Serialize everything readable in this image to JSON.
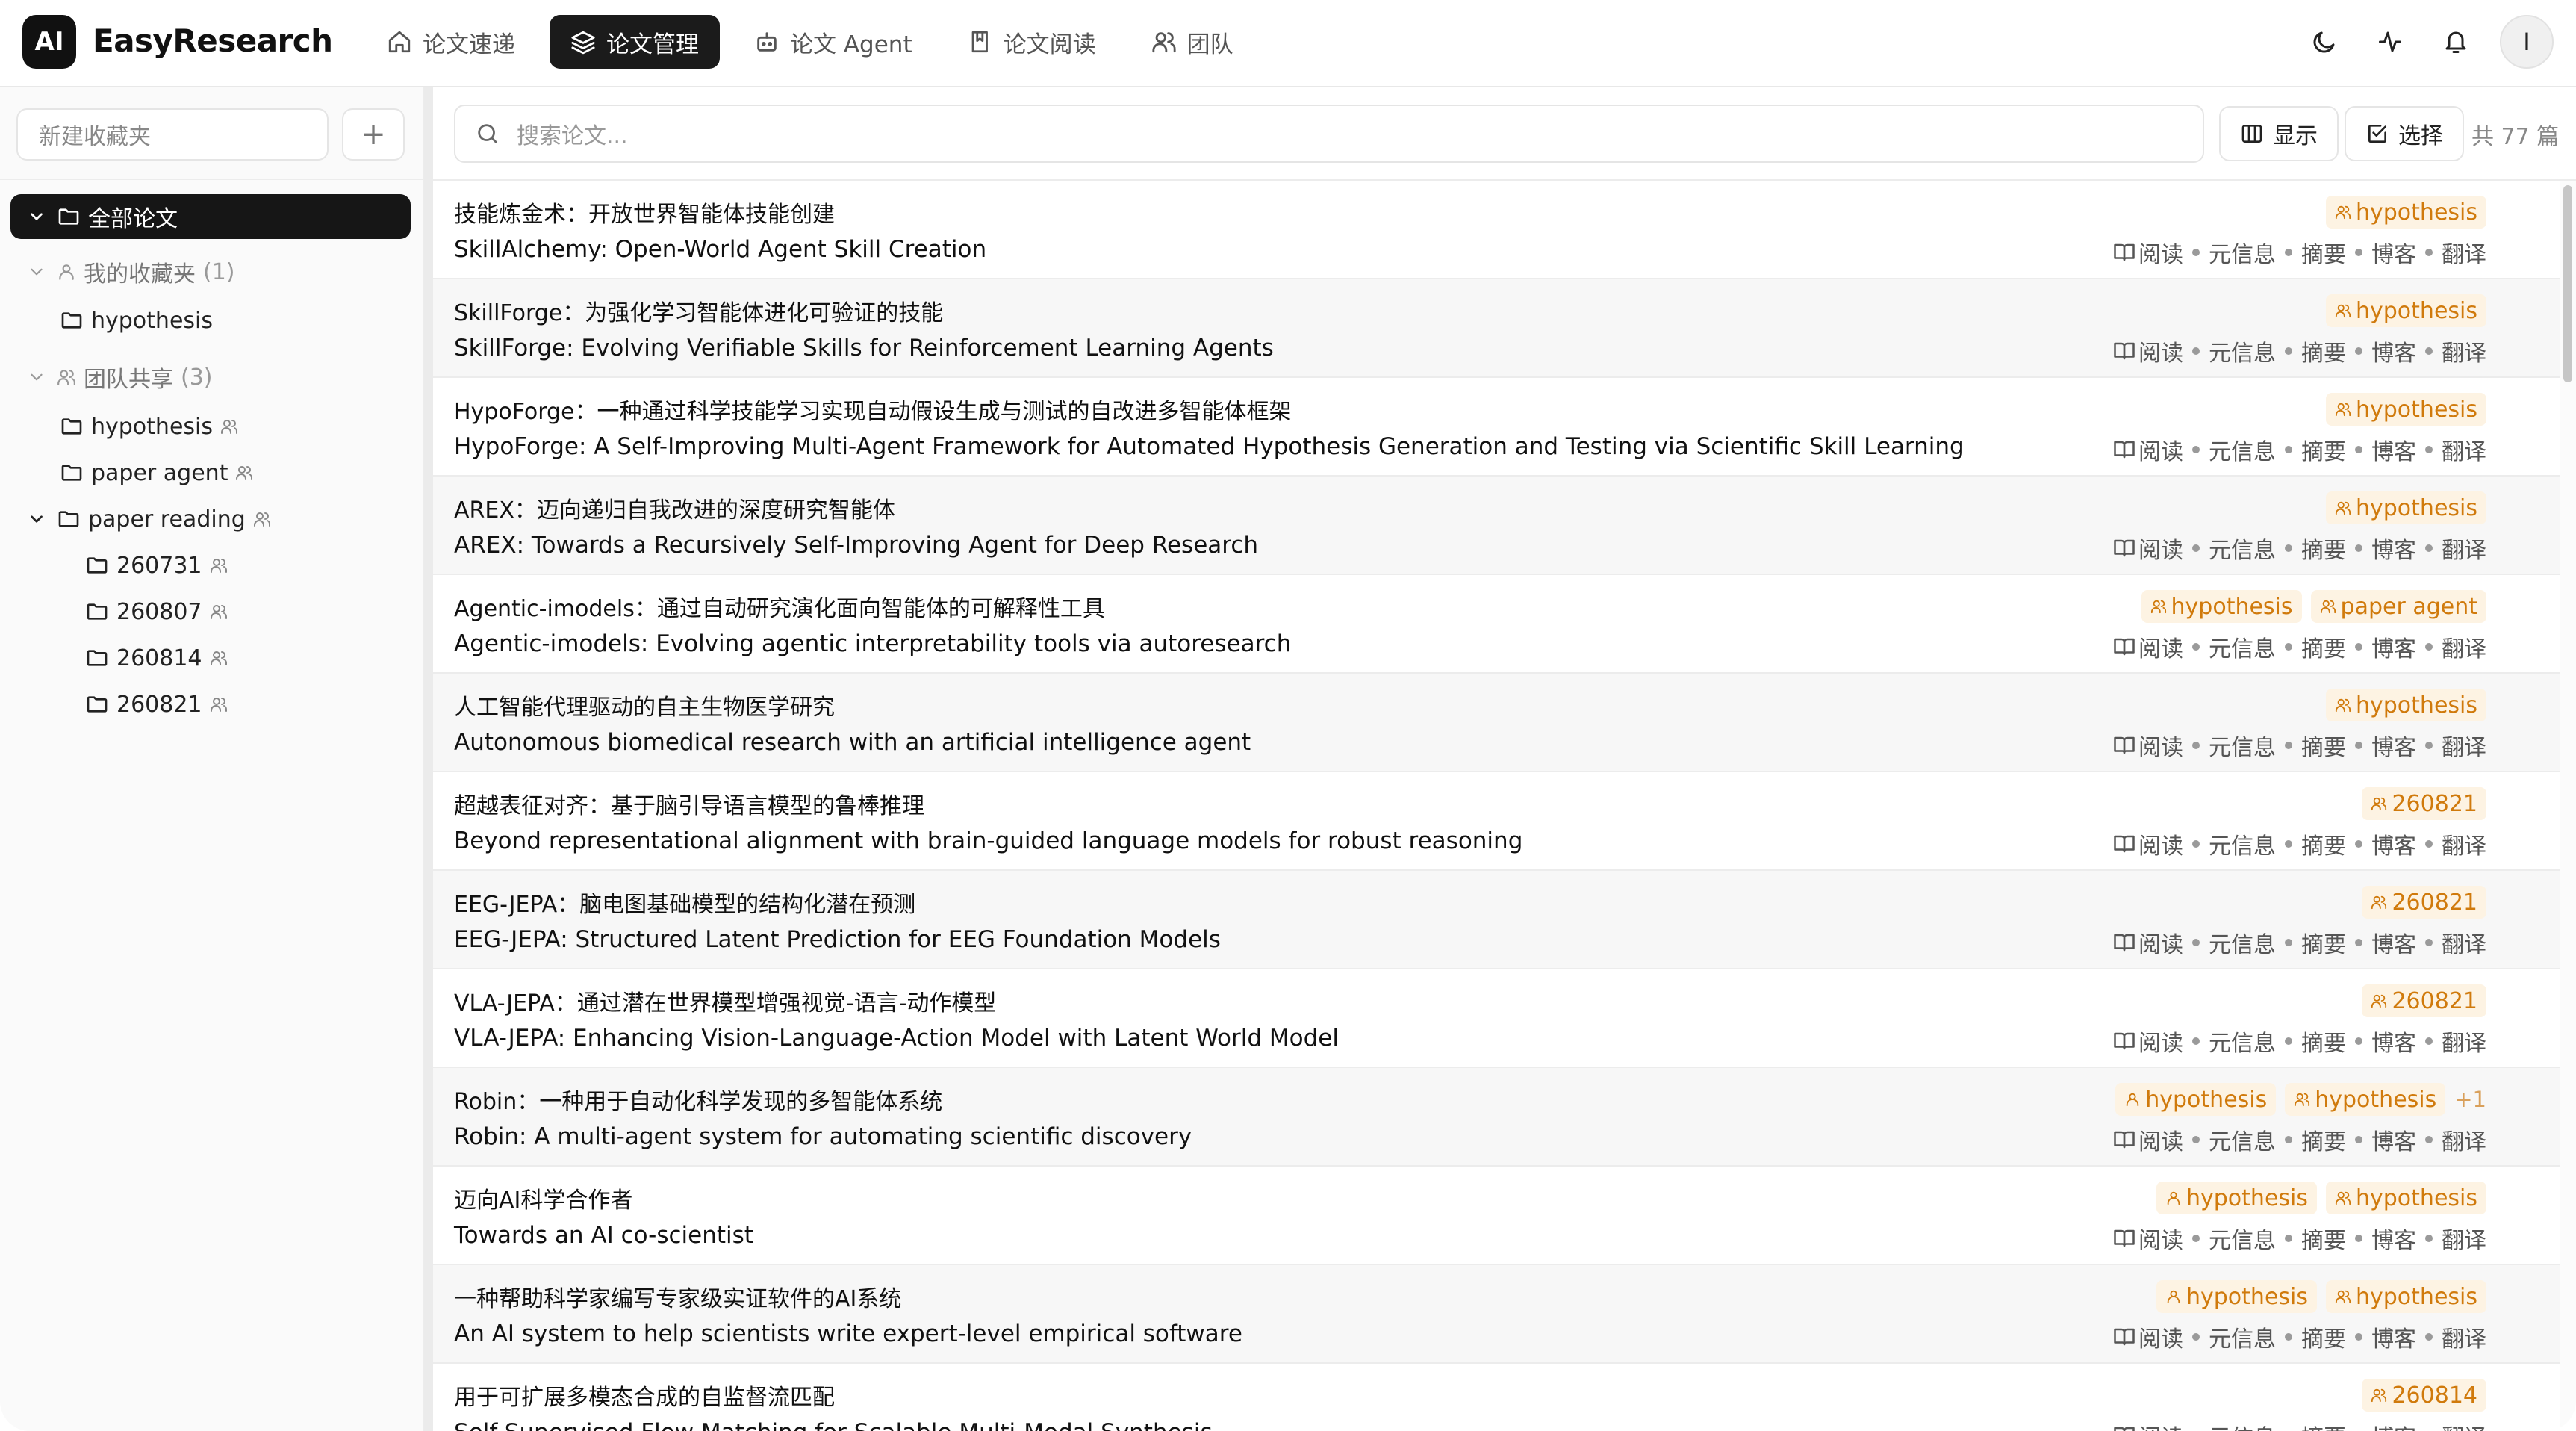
{
  "app": {
    "logo_text": "AI",
    "name": "EasyResearch"
  },
  "nav": [
    {
      "label": "论文速递",
      "icon": "home-icon",
      "active": false
    },
    {
      "label": "论文管理",
      "icon": "layers-icon",
      "active": true
    },
    {
      "label": "论文 Agent",
      "icon": "bot-icon",
      "active": false
    },
    {
      "label": "论文阅读",
      "icon": "book-icon",
      "active": false
    },
    {
      "label": "团队",
      "icon": "users-icon",
      "active": false
    }
  ],
  "header_icons": [
    "moon-icon",
    "activity-icon",
    "bell-icon"
  ],
  "user": {
    "initial": "I"
  },
  "sidebar": {
    "new_folder_placeholder": "新建收藏夹",
    "add_label": "+",
    "all_papers": "全部论文",
    "my_favorites": {
      "label": "我的收藏夹",
      "count": "(1)",
      "folders": [
        "hypothesis"
      ]
    },
    "team_shared": {
      "label": "团队共享",
      "count": "(3)",
      "folders": [
        "hypothesis",
        "paper agent",
        "paper reading"
      ],
      "subfolders": [
        "260731",
        "260807",
        "260814",
        "260821"
      ]
    }
  },
  "toolbar": {
    "search_placeholder": "搜索论文...",
    "display_label": "显示",
    "select_label": "选择",
    "total_label": "共 77 篇"
  },
  "action_labels": [
    "阅读",
    "元信息",
    "摘要",
    "博客",
    "翻译"
  ],
  "papers": [
    {
      "title_zh": "技能炼金术：开放世界智能体技能创建",
      "title_en": "SkillAlchemy: Open-World Agent Skill Creation",
      "tags": [
        {
          "label": "hypothesis",
          "icon": "users-icon"
        }
      ],
      "more": ""
    },
    {
      "title_zh": "SkillForge：为强化学习智能体进化可验证的技能",
      "title_en": "SkillForge: Evolving Verifiable Skills for Reinforcement Learning Agents",
      "tags": [
        {
          "label": "hypothesis",
          "icon": "users-icon"
        }
      ],
      "more": ""
    },
    {
      "title_zh": "HypoForge：一种通过科学技能学习实现自动假设生成与测试的自改进多智能体框架",
      "title_en": "HypoForge: A Self-Improving Multi-Agent Framework for Automated Hypothesis Generation and Testing via Scientific Skill Learning",
      "tags": [
        {
          "label": "hypothesis",
          "icon": "users-icon"
        }
      ],
      "more": ""
    },
    {
      "title_zh": "AREX：迈向递归自我改进的深度研究智能体",
      "title_en": "AREX: Towards a Recursively Self-Improving Agent for Deep Research",
      "tags": [
        {
          "label": "hypothesis",
          "icon": "users-icon"
        }
      ],
      "more": ""
    },
    {
      "title_zh": "Agentic-imodels：通过自动研究演化面向智能体的可解释性工具",
      "title_en": "Agentic-imodels: Evolving agentic interpretability tools via autoresearch",
      "tags": [
        {
          "label": "hypothesis",
          "icon": "users-icon"
        },
        {
          "label": "paper agent",
          "icon": "users-icon"
        }
      ],
      "more": ""
    },
    {
      "title_zh": "人工智能代理驱动的自主生物医学研究",
      "title_en": "Autonomous biomedical research with an artificial intelligence agent",
      "tags": [
        {
          "label": "hypothesis",
          "icon": "users-icon"
        }
      ],
      "more": ""
    },
    {
      "title_zh": "超越表征对齐：基于脑引导语言模型的鲁棒推理",
      "title_en": "Beyond representational alignment with brain-guided language models for robust reasoning",
      "tags": [
        {
          "label": "260821",
          "icon": "users-icon"
        }
      ],
      "more": ""
    },
    {
      "title_zh": "EEG-JEPA：脑电图基础模型的结构化潜在预测",
      "title_en": "EEG-JEPA: Structured Latent Prediction for EEG Foundation Models",
      "tags": [
        {
          "label": "260821",
          "icon": "users-icon"
        }
      ],
      "more": ""
    },
    {
      "title_zh": "VLA-JEPA：通过潜在世界模型增强视觉-语言-动作模型",
      "title_en": "VLA-JEPA: Enhancing Vision-Language-Action Model with Latent World Model",
      "tags": [
        {
          "label": "260821",
          "icon": "users-icon"
        }
      ],
      "more": ""
    },
    {
      "title_zh": "Robin：一种用于自动化科学发现的多智能体系统",
      "title_en": "Robin: A multi-agent system for automating scientific discovery",
      "tags": [
        {
          "label": "hypothesis",
          "icon": "user-icon"
        },
        {
          "label": "hypothesis",
          "icon": "users-icon"
        }
      ],
      "more": "+1"
    },
    {
      "title_zh": "迈向AI科学合作者",
      "title_en": "Towards an AI co-scientist",
      "tags": [
        {
          "label": "hypothesis",
          "icon": "user-icon"
        },
        {
          "label": "hypothesis",
          "icon": "users-icon"
        }
      ],
      "more": ""
    },
    {
      "title_zh": "一种帮助科学家编写专家级实证软件的AI系统",
      "title_en": "An AI system to help scientists write expert-level empirical software",
      "tags": [
        {
          "label": "hypothesis",
          "icon": "user-icon"
        },
        {
          "label": "hypothesis",
          "icon": "users-icon"
        }
      ],
      "more": ""
    },
    {
      "title_zh": "用于可扩展多模态合成的自监督流匹配",
      "title_en": "Self-Supervised Flow Matching for Scalable Multi-Modal Synthesis",
      "tags": [
        {
          "label": "260814",
          "icon": "users-icon"
        }
      ],
      "more": ""
    }
  ]
}
